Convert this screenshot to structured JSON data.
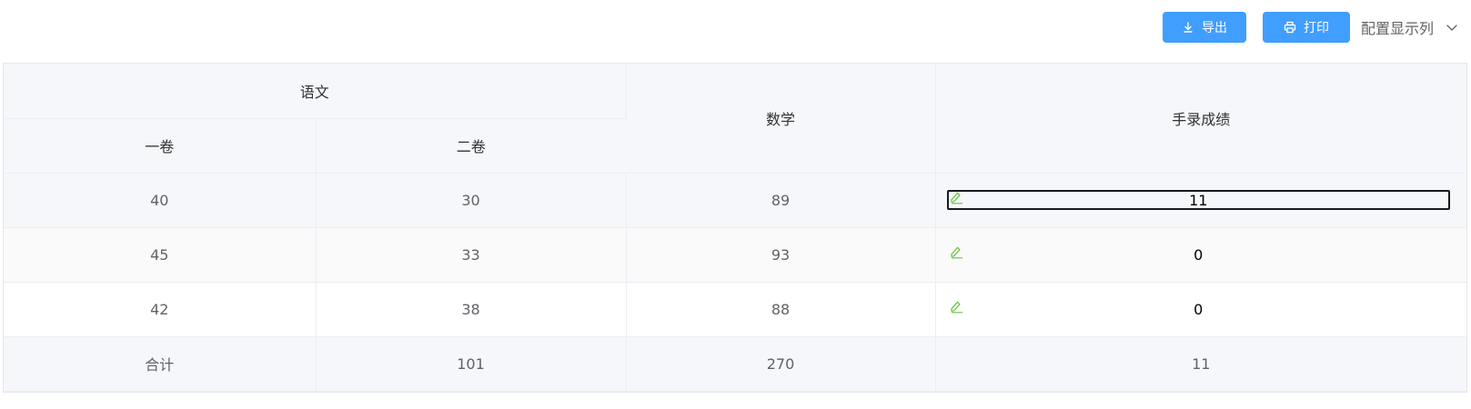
{
  "toolbar": {
    "export_label": "导出",
    "print_label": "打印",
    "column_config_label": "配置显示列"
  },
  "table": {
    "headers": {
      "chinese": "语文",
      "paper1": "一卷",
      "paper2": "二卷",
      "math": "数学",
      "manual_score": "手录成绩"
    },
    "rows": [
      {
        "paper1": "40",
        "paper2": "30",
        "math": "89",
        "manual": "11"
      },
      {
        "paper1": "45",
        "paper2": "33",
        "math": "93",
        "manual": "0"
      },
      {
        "paper1": "42",
        "paper2": "38",
        "math": "88",
        "manual": "0"
      }
    ],
    "summary": {
      "label": "合计",
      "paper2": "101",
      "math": "270",
      "manual": "11"
    }
  },
  "colors": {
    "primary": "#409eff",
    "edit_icon": "#67c23a",
    "header_bg": "#f5f7fa"
  },
  "icons": {
    "export": "download-icon",
    "print": "printer-icon",
    "config": "chevron-down-icon",
    "edit": "pencil-icon"
  }
}
